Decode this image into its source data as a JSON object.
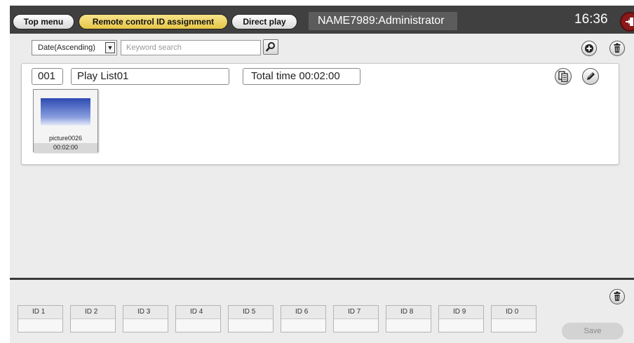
{
  "topbar": {
    "tabs": [
      {
        "label": "Top menu",
        "active": false
      },
      {
        "label": "Remote control ID assignment",
        "active": true
      },
      {
        "label": "Direct play",
        "active": false
      }
    ],
    "user": "NAME7989:Administrator",
    "clock": "16:36",
    "logout_icon": "logout-icon"
  },
  "toolbar": {
    "sort_value": "Date(Ascending)",
    "search_placeholder": "Keyword search",
    "icons": [
      "search-icon",
      "add-icon",
      "trash-icon"
    ]
  },
  "playlist": {
    "number": "001",
    "name": "Play List01",
    "total_time": "Total time 00:02:00",
    "icons": [
      "copy-icon",
      "edit-icon"
    ],
    "items": [
      {
        "name": "picture0026",
        "duration": "00:02:00"
      }
    ]
  },
  "assignment": {
    "slots": [
      "ID 1",
      "ID 2",
      "ID 3",
      "ID 4",
      "ID 5",
      "ID 6",
      "ID 7",
      "ID 8",
      "ID 9",
      "ID 0"
    ],
    "save_label": "Save"
  },
  "colors": {
    "active_tab": "#e9c94e",
    "frame": "#3a3a3a",
    "panel": "#ececec",
    "logout": "#8a1a1a"
  }
}
